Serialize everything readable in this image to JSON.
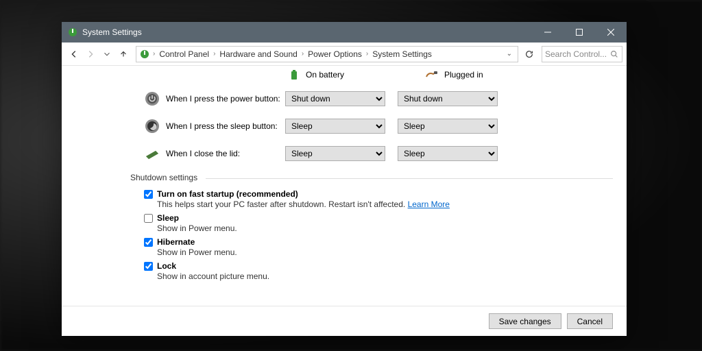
{
  "window": {
    "title": "System Settings"
  },
  "breadcrumb": [
    "Control Panel",
    "Hardware and Sound",
    "Power Options",
    "System Settings"
  ],
  "search": {
    "placeholder": "Search Control..."
  },
  "columns": {
    "battery": "On battery",
    "plugged": "Plugged in"
  },
  "rows": {
    "power": {
      "label": "When I press the power button:",
      "battery": "Shut down",
      "plugged": "Shut down"
    },
    "sleep": {
      "label": "When I press the sleep button:",
      "battery": "Sleep",
      "plugged": "Sleep"
    },
    "lid": {
      "label": "When I close the lid:",
      "battery": "Sleep",
      "plugged": "Sleep"
    }
  },
  "section": "Shutdown settings",
  "checks": {
    "fast": {
      "checked": true,
      "label": "Turn on fast startup (recommended)",
      "desc": "This helps start your PC faster after shutdown. Restart isn't affected.",
      "link": "Learn More"
    },
    "sleep": {
      "checked": false,
      "label": "Sleep",
      "desc": "Show in Power menu."
    },
    "hib": {
      "checked": true,
      "label": "Hibernate",
      "desc": "Show in Power menu."
    },
    "lock": {
      "checked": true,
      "label": "Lock",
      "desc": "Show in account picture menu."
    }
  },
  "footer": {
    "save": "Save changes",
    "cancel": "Cancel"
  }
}
